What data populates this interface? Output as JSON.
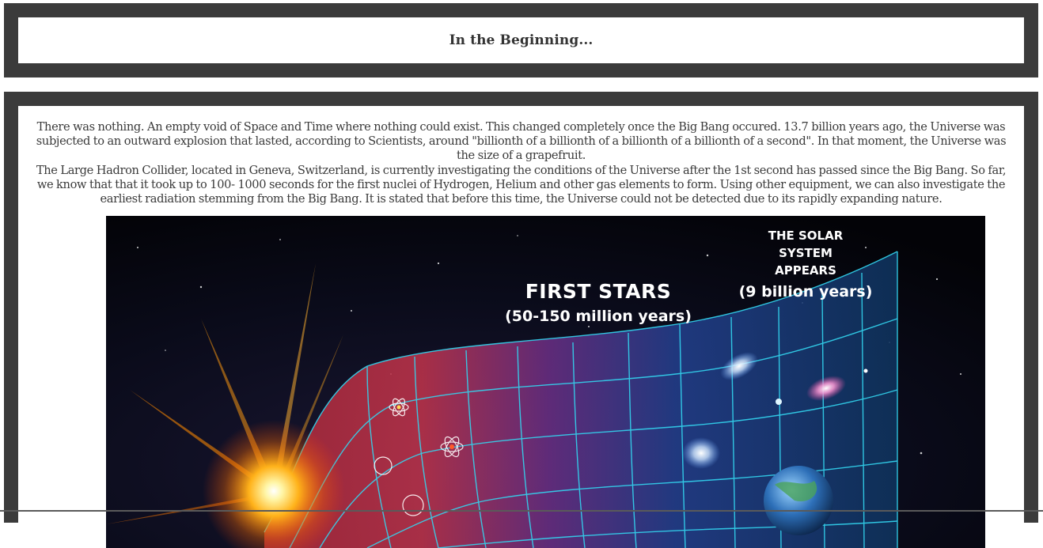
{
  "header": {
    "title": "In the Beginning..."
  },
  "main": {
    "paragraphs": [
      "There was nothing. An empty void of Space and Time where nothing could exist. This changed completely once the Big Bang occured. 13.7 billion years ago, the Universe was subjected to an outward explosion that lasted, according to Scientists, around \"billionth of a billionth of a billionth of a billionth of a second\". In that moment, the Universe was the size of a grapefruit.",
      "The Large Hadron Collider, located in Geneva, Switzerland, is currently investigating the conditions of the Universe after the 1st second has passed since the Big Bang. So far, we know that that it took up to 100- 1000 seconds for the first nuclei of Hydrogen, Helium and other gas elements to form. Using other equipment, we can also investigate the earliest radiation stemming from the Big Bang. It is stated that before this time, the Universe could not be detected due to its rapidly expanding nature."
    ],
    "image": {
      "labels": {
        "first_stars_title": "FIRST STARS",
        "first_stars_time": "(50-150 million years)",
        "solar_line1": "THE SOLAR",
        "solar_line2": "SYSTEM",
        "solar_line3": "APPEARS",
        "solar_time": "(9 billion years)"
      }
    }
  },
  "colors": {
    "frame": "#3b3b3b",
    "text": "#3a3a3a",
    "grid": "#33d6f0"
  }
}
